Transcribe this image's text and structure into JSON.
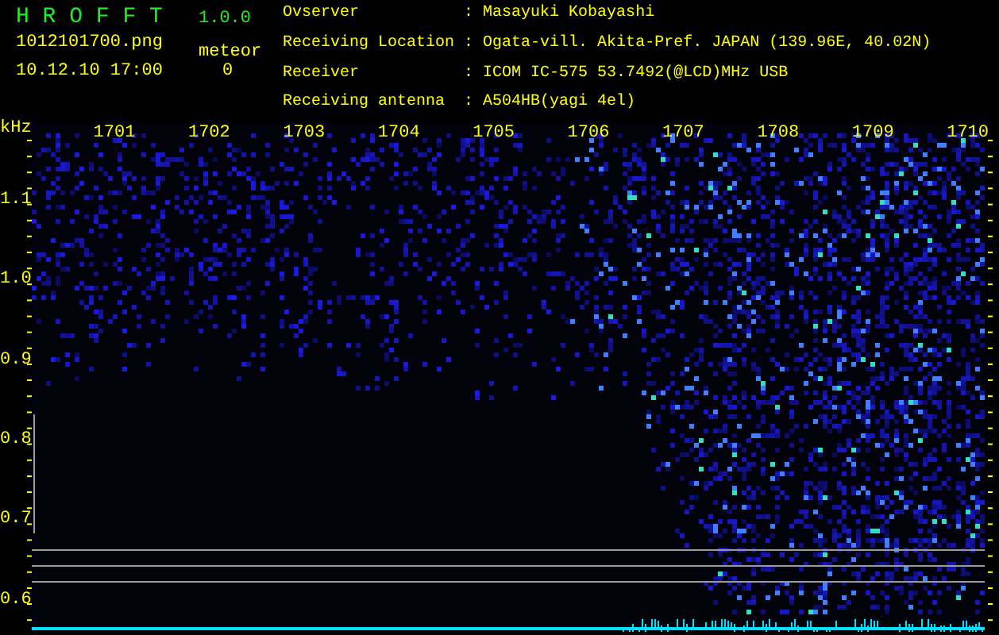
{
  "app": {
    "title": "H R O F F T",
    "version": "1.0.0",
    "filename": "1012101700.png",
    "datetime": "10.12.10 17:00",
    "meteor_label": "meteor",
    "meteor_count": "0"
  },
  "info": [
    {
      "label": "Ovserver",
      "separator": ":",
      "value": "Masayuki Kobayashi"
    },
    {
      "label": "Receiving Location",
      "separator": ":",
      "value": "Ogata-vill. Akita-Pref. JAPAN (139.96E, 40.02N)"
    },
    {
      "label": "Receiver",
      "separator": ":",
      "value": "ICOM IC-575 53.7492(@LCD)MHz USB"
    },
    {
      "label": "Receiving antenna",
      "separator": ":",
      "value": "A504HB(yagi 4el)"
    }
  ],
  "spectrogram": {
    "y_unit": "kHz",
    "x_labels": [
      "1701",
      "1702",
      "1703",
      "1704",
      "1705",
      "1706",
      "1707",
      "1708",
      "1709",
      "1710"
    ],
    "y_labels": [
      "1.1",
      "1.0",
      "0.9",
      "0.8",
      "0.7",
      "0.6"
    ]
  }
}
